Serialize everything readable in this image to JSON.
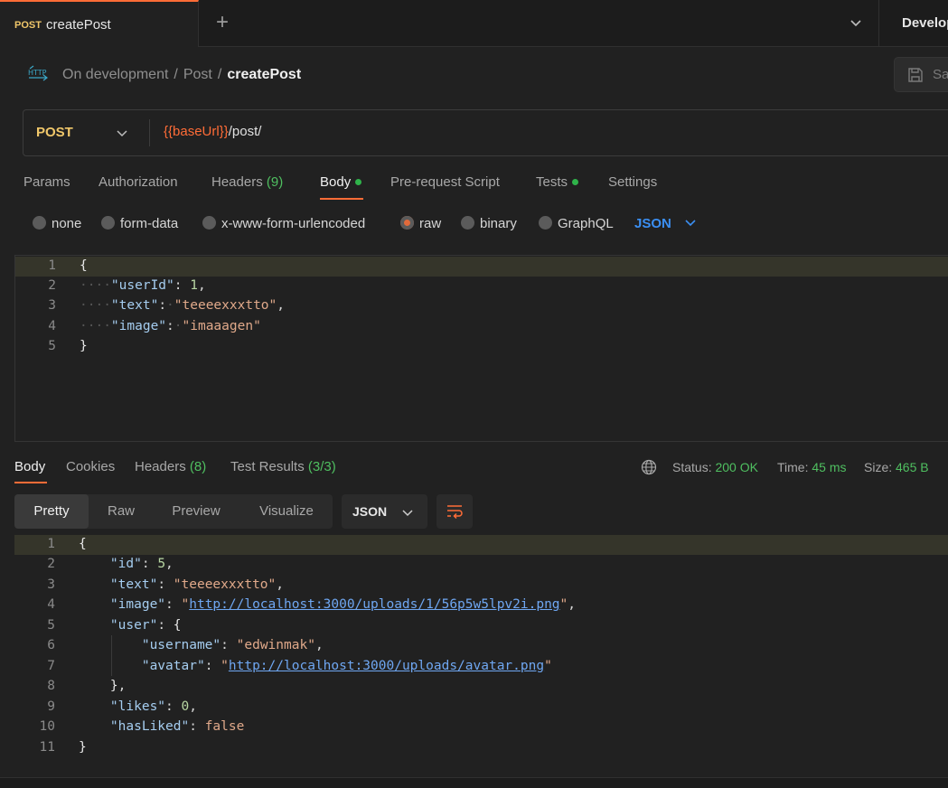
{
  "tabs": {
    "active": {
      "method": "POST",
      "title": "createPost"
    },
    "env_label": "Develop"
  },
  "breadcrumb": {
    "icon": "http-icon",
    "items": [
      "On development",
      "Post",
      "createPost"
    ]
  },
  "save": {
    "label": "Sa"
  },
  "request": {
    "method": "POST",
    "url_var": "{{baseUrl}}",
    "url_path": "/post/"
  },
  "request_tabs": [
    {
      "label": "Params"
    },
    {
      "label": "Authorization"
    },
    {
      "label": "Headers",
      "count": "(9)"
    },
    {
      "label": "Body",
      "dot": true
    },
    {
      "label": "Pre-request Script"
    },
    {
      "label": "Tests",
      "dot": true
    },
    {
      "label": "Settings"
    }
  ],
  "body_types": {
    "options": [
      "none",
      "form-data",
      "x-www-form-urlencoded",
      "raw",
      "binary",
      "GraphQL"
    ],
    "selected": "raw",
    "format": "JSON"
  },
  "request_body": {
    "line_numbers": [
      "1",
      "2",
      "3",
      "4",
      "5"
    ]
  },
  "response_tabs": [
    {
      "label": "Body"
    },
    {
      "label": "Cookies"
    },
    {
      "label": "Headers",
      "count": "(8)"
    },
    {
      "label": "Test Results",
      "count": "(3/3)"
    }
  ],
  "response_status": {
    "status_label": "Status:",
    "status_value": "200 OK",
    "time_label": "Time:",
    "time_value": "45 ms",
    "size_label": "Size:",
    "size_value": "465 B"
  },
  "response_views": [
    "Pretty",
    "Raw",
    "Preview",
    "Visualize"
  ],
  "response_format": "JSON",
  "response_body": {
    "line_numbers": [
      "1",
      "2",
      "3",
      "4",
      "5",
      "6",
      "7",
      "8",
      "9",
      "10",
      "11"
    ]
  },
  "colors": {
    "accent": "#ff6c37",
    "success": "#4fbf60",
    "method_post": "#f0c76a",
    "link": "#6fa7f2"
  }
}
